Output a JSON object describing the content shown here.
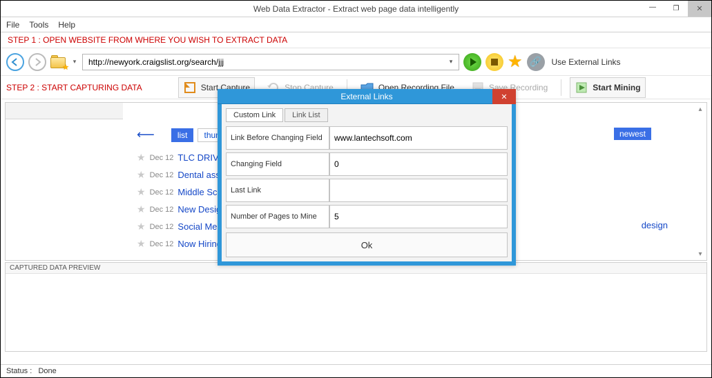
{
  "window": {
    "title": "Web Data Extractor -  Extract web page data intelligently"
  },
  "menu": {
    "file": "File",
    "tools": "Tools",
    "help": "Help"
  },
  "step1": "STEP 1 : OPEN WEBSITE FROM WHERE YOU WISH TO EXTRACT DATA",
  "nav": {
    "url": "http://newyork.craigslist.org/search/jjj",
    "external_label": "Use External Links"
  },
  "step2": "STEP 2 : START CAPTURING DATA",
  "toolbar": {
    "start_capture": "Start Capture",
    "stop_capture": "Stop Capture",
    "open_recording": "Open Recording File",
    "save_recording": "Save Recording",
    "start_mining": "Start Mining"
  },
  "browser": {
    "tab_list": "list",
    "tab_thumb": "thumb",
    "newest": "newest",
    "side": "design",
    "rows": [
      {
        "date": "Dec 12",
        "title": "TLC DRIVE"
      },
      {
        "date": "Dec 12",
        "title": "Dental assista"
      },
      {
        "date": "Dec 12",
        "title": "Middle Schoo"
      },
      {
        "date": "Dec 12",
        "title": "New Designe"
      },
      {
        "date": "Dec 12",
        "title": "Social Media"
      },
      {
        "date": "Dec 12",
        "title": "Now Hiring I"
      }
    ]
  },
  "captured": {
    "header": "CAPTURED DATA PREVIEW"
  },
  "status": {
    "label": "Status :",
    "value": "Done"
  },
  "modal": {
    "title": "External Links",
    "tab_custom": "Custom Link",
    "tab_list": "Link List",
    "field1_label": "Link Before Changing Field",
    "field1_value": "www.lantechsoft.com",
    "field2_label": "Changing Field",
    "field2_value": "0",
    "field3_label": "Last Link",
    "field3_value": "",
    "field4_label": "Number of Pages to Mine",
    "field4_value": "5",
    "ok": "Ok"
  }
}
